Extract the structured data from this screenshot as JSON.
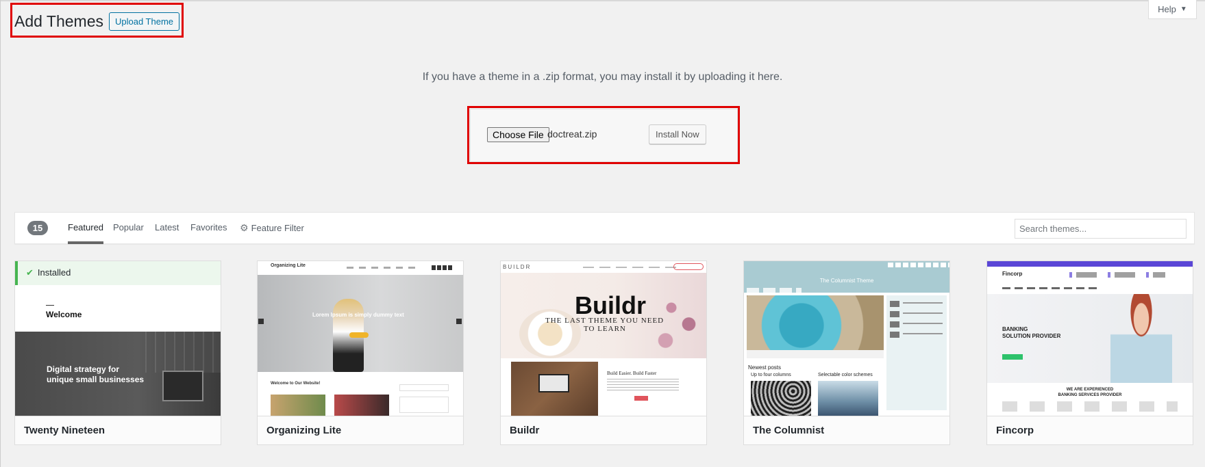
{
  "header": {
    "title": "Add Themes",
    "upload_button": "Upload Theme",
    "help": "Help"
  },
  "upload": {
    "description": "If you have a theme in a .zip format, you may install it by uploading it here.",
    "choose_file": "Choose File",
    "file_name": "doctreat.zip",
    "install_button": "Install Now"
  },
  "filter": {
    "count": "15",
    "tabs": [
      "Featured",
      "Popular",
      "Latest",
      "Favorites"
    ],
    "feature_filter": "Feature Filter",
    "search_placeholder": "Search themes..."
  },
  "themes": [
    {
      "name": "Twenty Nineteen",
      "installed": "Installed",
      "preview": {
        "welcome": "Welcome",
        "headline_1": "Digital strategy for",
        "headline_2": "unique small businesses"
      }
    },
    {
      "name": "Organizing Lite",
      "preview": {
        "logo": "Organizing Lite",
        "hero": "Lorem Ipsum is simply dummy text",
        "section": "Welcome to Our Website!"
      }
    },
    {
      "name": "Buildr",
      "preview": {
        "logo": "BUILDR",
        "big_logo": "Buildr",
        "tagline_1": "THE LAST THEME YOU NEED",
        "tagline_2": "TO LEARN",
        "subhead": "Build Easier. Build Faster"
      }
    },
    {
      "name": "The Columnist",
      "preview": {
        "banner": "The Columnist Theme",
        "newest": "Newest posts",
        "col_1": "Up to four columns",
        "col_2": "Selectable color schemes"
      }
    },
    {
      "name": "Fincorp",
      "preview": {
        "logo": "Fincorp",
        "hero_1": "BANKING",
        "hero_2": "SOLUTION PROVIDER",
        "sub_1": "WE ARE EXPERIENCED",
        "sub_2": "BANKING SERVICES PROVIDER"
      }
    }
  ],
  "colors": {
    "accent": "#0071a1",
    "annotation": "#e00000",
    "installed": "#46b450"
  }
}
